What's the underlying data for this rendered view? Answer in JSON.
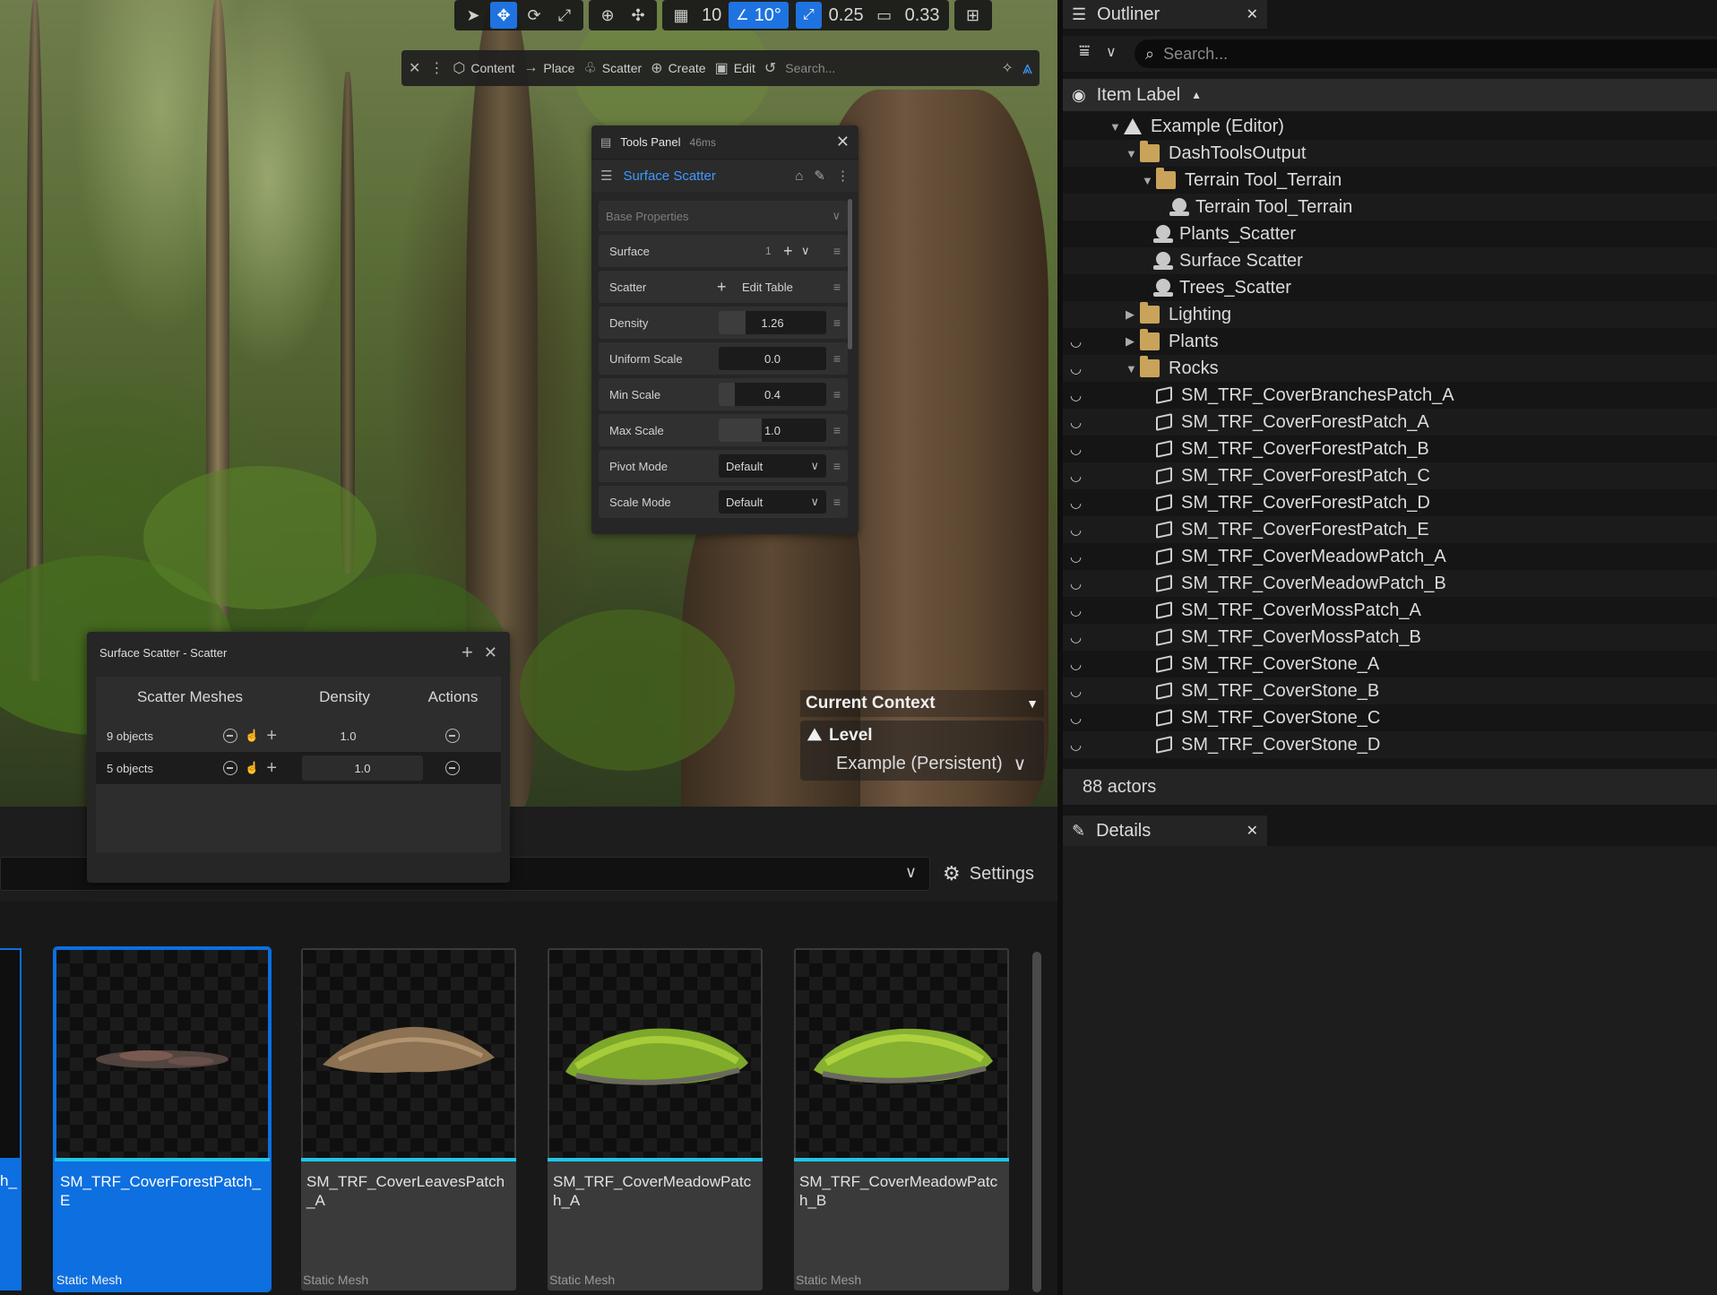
{
  "viewport_toolbar": {
    "grid_value": "10",
    "angle_value": "10°",
    "scale_value": "0.25",
    "camera_value": "0.33"
  },
  "mode_toolbar": {
    "content": "Content",
    "place": "Place",
    "scatter": "Scatter",
    "create": "Create",
    "edit": "Edit",
    "search_placeholder": "Search..."
  },
  "tools_panel": {
    "title": "Tools Panel",
    "timing": "46ms",
    "tool_name": "Surface Scatter",
    "section": "Base Properties",
    "surface_label": "Surface",
    "surface_count": "1",
    "scatter_label": "Scatter",
    "edit_table": "Edit Table",
    "density_label": "Density",
    "density_value": "1.26",
    "uniform_scale_label": "Uniform Scale",
    "uniform_scale_value": "0.0",
    "min_scale_label": "Min Scale",
    "min_scale_value": "0.4",
    "max_scale_label": "Max Scale",
    "max_scale_value": "1.0",
    "pivot_mode_label": "Pivot Mode",
    "pivot_mode_value": "Default",
    "scale_mode_label": "Scale Mode",
    "scale_mode_value": "Default"
  },
  "scatter_dialog": {
    "title": "Surface Scatter - Scatter",
    "col_meshes": "Scatter Meshes",
    "col_density": "Density",
    "col_actions": "Actions",
    "rows": [
      {
        "objects": "9 objects",
        "density": "1.0"
      },
      {
        "objects": "5 objects",
        "density": "1.0"
      }
    ]
  },
  "current_context": {
    "title": "Current Context",
    "level_label": "Level",
    "level_value": "Example (Persistent)"
  },
  "content_browser": {
    "settings": "Settings",
    "partial_left_name": "h_",
    "assets": [
      {
        "name": "SM_TRF_CoverForestPatch_E",
        "type": "Static Mesh",
        "selected": true
      },
      {
        "name": "SM_TRF_CoverLeavesPatch_A",
        "type": "Static Mesh",
        "selected": false
      },
      {
        "name": "SM_TRF_CoverMeadowPatch_A",
        "type": "Static Mesh",
        "selected": false
      },
      {
        "name": "SM_TRF_CoverMeadowPatch_B",
        "type": "Static Mesh",
        "selected": false
      }
    ]
  },
  "outliner": {
    "tab": "Outliner",
    "search_placeholder": "Search...",
    "column": "Item Label",
    "items": [
      {
        "label": "Example (Editor)",
        "kind": "level",
        "depth": 0,
        "expand": "open"
      },
      {
        "label": "DashToolsOutput",
        "kind": "folder",
        "depth": 1,
        "expand": "open"
      },
      {
        "label": "Terrain Tool_Terrain",
        "kind": "folder",
        "depth": 2,
        "expand": "open"
      },
      {
        "label": "Terrain Tool_Terrain",
        "kind": "actor",
        "depth": 3,
        "expand": ""
      },
      {
        "label": "Plants_Scatter",
        "kind": "actor",
        "depth": 2,
        "expand": ""
      },
      {
        "label": "Surface Scatter",
        "kind": "actor",
        "depth": 2,
        "expand": ""
      },
      {
        "label": "Trees_Scatter",
        "kind": "actor",
        "depth": 2,
        "expand": ""
      },
      {
        "label": "Lighting",
        "kind": "folder",
        "depth": 1,
        "expand": "closed"
      },
      {
        "label": "Plants",
        "kind": "folder",
        "depth": 1,
        "expand": "closed"
      },
      {
        "label": "Rocks",
        "kind": "folder",
        "depth": 1,
        "expand": "open"
      },
      {
        "label": "SM_TRF_CoverBranchesPatch_A",
        "kind": "mesh",
        "depth": 2,
        "expand": ""
      },
      {
        "label": "SM_TRF_CoverForestPatch_A",
        "kind": "mesh",
        "depth": 2,
        "expand": ""
      },
      {
        "label": "SM_TRF_CoverForestPatch_B",
        "kind": "mesh",
        "depth": 2,
        "expand": ""
      },
      {
        "label": "SM_TRF_CoverForestPatch_C",
        "kind": "mesh",
        "depth": 2,
        "expand": ""
      },
      {
        "label": "SM_TRF_CoverForestPatch_D",
        "kind": "mesh",
        "depth": 2,
        "expand": ""
      },
      {
        "label": "SM_TRF_CoverForestPatch_E",
        "kind": "mesh",
        "depth": 2,
        "expand": ""
      },
      {
        "label": "SM_TRF_CoverMeadowPatch_A",
        "kind": "mesh",
        "depth": 2,
        "expand": ""
      },
      {
        "label": "SM_TRF_CoverMeadowPatch_B",
        "kind": "mesh",
        "depth": 2,
        "expand": ""
      },
      {
        "label": "SM_TRF_CoverMossPatch_A",
        "kind": "mesh",
        "depth": 2,
        "expand": ""
      },
      {
        "label": "SM_TRF_CoverMossPatch_B",
        "kind": "mesh",
        "depth": 2,
        "expand": ""
      },
      {
        "label": "SM_TRF_CoverStone_A",
        "kind": "mesh",
        "depth": 2,
        "expand": ""
      },
      {
        "label": "SM_TRF_CoverStone_B",
        "kind": "mesh",
        "depth": 2,
        "expand": ""
      },
      {
        "label": "SM_TRF_CoverStone_C",
        "kind": "mesh",
        "depth": 2,
        "expand": ""
      },
      {
        "label": "SM_TRF_CoverStone_D",
        "kind": "mesh",
        "depth": 2,
        "expand": ""
      }
    ],
    "count": "88 actors"
  },
  "details": {
    "tab": "Details"
  },
  "colors": {
    "accent": "#1e73e0",
    "link_blue": "#3d9bff",
    "asset_line": "#1fc6e8"
  }
}
